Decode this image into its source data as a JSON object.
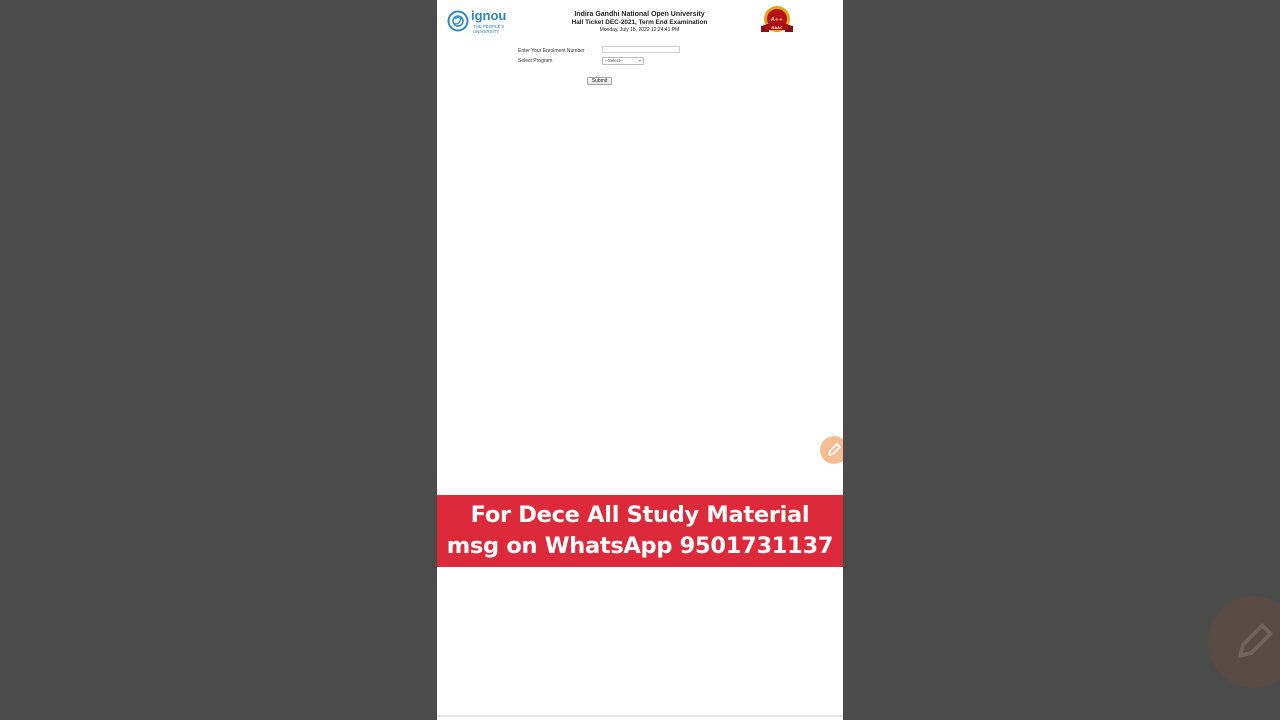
{
  "header": {
    "logo_brand": "ignou",
    "logo_tagline_1": "THE PEOPLE'S",
    "logo_tagline_2": "UNIVERSITY",
    "university_name": "Indira Gandhi National Open University",
    "ticket_title": "Hall Ticket DEC-2021, Term End Examination",
    "datetime": "Monday, July 18, 2022 12:24:41 PM",
    "badge_text": "NAAC",
    "badge_grade": "A++"
  },
  "form": {
    "enrollment_label": "Enter Your Enrolment Number",
    "enrollment_value": "",
    "program_label": "Select Program",
    "program_selected": "--Select--",
    "submit_label": "Submit"
  },
  "banner": {
    "line1": "For Dece All Study Material",
    "line2": "msg on WhatsApp 9501731137"
  },
  "colors": {
    "background": "#4b4b4b",
    "banner_red": "#dd2a3a",
    "ignou_blue": "#2f86c6",
    "fab_orange": "#f2a86d"
  },
  "icons": {
    "edit_fab": "pencil-icon",
    "ghost_fab": "pencil-icon",
    "logo_mark": "ignou-logo-icon",
    "badge": "naac-seal-icon",
    "select_chevron": "chevron-down-icon"
  }
}
